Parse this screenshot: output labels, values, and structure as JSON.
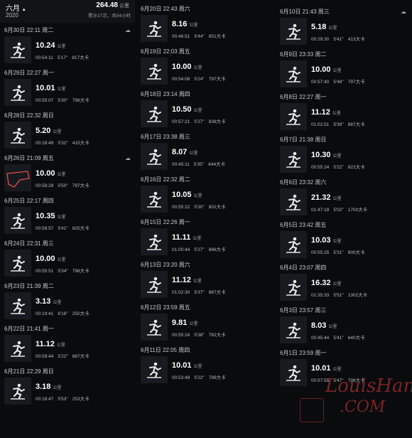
{
  "header": {
    "month": "六月",
    "month_arrow": "▲",
    "year": "2020",
    "total_km": "264.48",
    "unit_km": "公里",
    "summary": "累计27次，共54小时"
  },
  "labels": {
    "unit_km": "公里"
  },
  "colors": {
    "background": "#0a0b0d",
    "card": "#171a1e",
    "route": "#e24b4b",
    "watermark": "#d63c3c"
  },
  "icons": {
    "run": "running-figure-icon",
    "weather": "cloud-icon"
  },
  "columns": [
    {
      "runs": [
        {
          "date": "6月30日  22:11  周二",
          "weather": "☁",
          "dist": "10.24",
          "time": "00:54:11",
          "pace": "5'17\"",
          "cal": "817大卡",
          "thumb": "run"
        },
        {
          "date": "6月29日  22:27  周一",
          "weather": "",
          "dist": "10.01",
          "time": "00:55:07",
          "pace": "5'30\"",
          "cal": "798大卡",
          "thumb": "run"
        },
        {
          "date": "6月28日  22:32  周日",
          "weather": "",
          "dist": "5.20",
          "time": "00:28:49",
          "pace": "5'32\"",
          "cal": "415大卡",
          "thumb": "run"
        },
        {
          "date": "6月26日  21:09  周五",
          "weather": "☁",
          "dist": "10.00",
          "time": "00:58:29",
          "pace": "5'50\"",
          "cal": "797大卡",
          "thumb": "route"
        },
        {
          "date": "6月25日  22:17  周四",
          "weather": "",
          "dist": "10.35",
          "time": "00:58:57",
          "pace": "5'41\"",
          "cal": "825大卡",
          "thumb": "run"
        },
        {
          "date": "6月24日  22:31  周三",
          "weather": "",
          "dist": "10.00",
          "time": "00:55:51",
          "pace": "5'34\"",
          "cal": "798大卡",
          "thumb": "run"
        },
        {
          "date": "6月23日  21:39  周二",
          "weather": "",
          "dist": "3.13",
          "time": "00:19:41",
          "pace": "6'16\"",
          "cal": "250大卡",
          "thumb": "run"
        },
        {
          "date": "6月22日  21:41  周一",
          "weather": "",
          "dist": "11.12",
          "time": "00:59:44",
          "pace": "5'22\"",
          "cal": "887大卡",
          "thumb": "run"
        },
        {
          "date": "6月21日  22:29  周日",
          "weather": "",
          "dist": "3.18",
          "time": "00:18:47",
          "pace": "5'53\"",
          "cal": "253大卡",
          "thumb": "run"
        }
      ]
    },
    {
      "runs": [
        {
          "date": "6月20日  22:43  周六",
          "weather": "",
          "dist": "8.16",
          "time": "00:46:51",
          "pace": "5'44\"",
          "cal": "651大卡",
          "thumb": "run"
        },
        {
          "date": "6月19日  22:03  周五",
          "weather": "",
          "dist": "10.00",
          "time": "00:54:08",
          "pace": "5'24\"",
          "cal": "797大卡",
          "thumb": "run"
        },
        {
          "date": "6月18日  23:14  周四",
          "weather": "",
          "dist": "10.50",
          "time": "00:57:21",
          "pace": "5'27\"",
          "cal": "838大卡",
          "thumb": "run"
        },
        {
          "date": "6月17日  23:38  周三",
          "weather": "",
          "dist": "8.07",
          "time": "00:45:11",
          "pace": "5'35\"",
          "cal": "644大卡",
          "thumb": "run"
        },
        {
          "date": "6月16日  22:32  周二",
          "weather": "",
          "dist": "10.05",
          "time": "00:55:22",
          "pace": "5'30\"",
          "cal": "802大卡",
          "thumb": "run"
        },
        {
          "date": "6月15日  22:26  周一",
          "weather": "",
          "dist": "11.11",
          "time": "01:00:44",
          "pace": "5'27\"",
          "cal": "886大卡",
          "thumb": "run"
        },
        {
          "date": "6月13日  23:20  周六",
          "weather": "",
          "dist": "11.12",
          "time": "01:02:30",
          "pace": "5'37\"",
          "cal": "887大卡",
          "thumb": "run"
        },
        {
          "date": "6月12日  23:59  周五",
          "weather": "",
          "dist": "9.81",
          "time": "00:55:24",
          "pace": "5'38\"",
          "cal": "782大卡",
          "thumb": "run"
        },
        {
          "date": "6月11日  22:05  周四",
          "weather": "",
          "dist": "10.01",
          "time": "00:53:49",
          "pace": "5'22\"",
          "cal": "799大卡",
          "thumb": "run"
        }
      ]
    },
    {
      "runs": [
        {
          "date": "6月10日  21:43  周三",
          "weather": "☁",
          "dist": "5.18",
          "time": "00:29:30",
          "pace": "5'41\"",
          "cal": "413大卡",
          "thumb": "run"
        },
        {
          "date": "6月9日  23:33  周二",
          "weather": "",
          "dist": "10.00",
          "time": "00:57:40",
          "pace": "5'46\"",
          "cal": "797大卡",
          "thumb": "run"
        },
        {
          "date": "6月8日  22:27  周一",
          "weather": "",
          "dist": "11.12",
          "time": "01:02:51",
          "pace": "5'39\"",
          "cal": "887大卡",
          "thumb": "run"
        },
        {
          "date": "6月7日  21:38  周日",
          "weather": "",
          "dist": "10.30",
          "time": "00:55:24",
          "pace": "5'22\"",
          "cal": "822大卡",
          "thumb": "run"
        },
        {
          "date": "6月6日  23:32  周六",
          "weather": "",
          "dist": "21.32",
          "time": "01:47:19",
          "pace": "5'02\"",
          "cal": "1700大卡",
          "thumb": "run"
        },
        {
          "date": "6月5日  23:42  周五",
          "weather": "",
          "dist": "10.03",
          "time": "00:55:25",
          "pace": "5'31\"",
          "cal": "800大卡",
          "thumb": "run"
        },
        {
          "date": "6月4日  23:07  周四",
          "weather": "",
          "dist": "16.32",
          "time": "01:35:33",
          "pace": "5'51\"",
          "cal": "1302大卡",
          "thumb": "run"
        },
        {
          "date": "6月3日  23:57  周三",
          "weather": "",
          "dist": "8.03",
          "time": "00:45:44",
          "pace": "5'41\"",
          "cal": "640大卡",
          "thumb": "run"
        },
        {
          "date": "6月1日  23:59  周一",
          "weather": "",
          "dist": "10.01",
          "time": "00:57:55",
          "pace": "5'47\"",
          "cal": "798大卡",
          "thumb": "run"
        }
      ]
    }
  ],
  "watermark": {
    "top": "LouisHan",
    "bottom": ".COM"
  }
}
